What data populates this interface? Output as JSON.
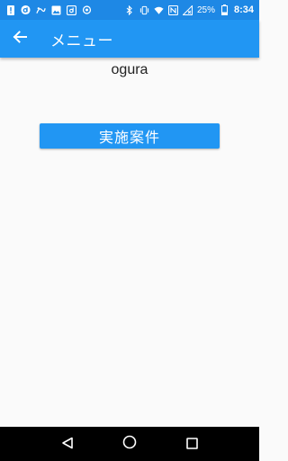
{
  "status_bar": {
    "battery": "25%",
    "time": "8:34"
  },
  "app_bar": {
    "title": "メニュー"
  },
  "main": {
    "user_name": "ogura",
    "action_button_label": "実施案件"
  },
  "colors": {
    "status_bar": "#1e88e5",
    "primary": "#2196f3",
    "background": "#fafafa",
    "nav_bar": "#000000"
  },
  "icons": {
    "status_left": [
      "alert-icon",
      "docomo-icon",
      "voice-icon",
      "image-icon",
      "docomo-app-icon",
      "sync-icon"
    ],
    "status_right": [
      "bluetooth-icon",
      "vibrate-icon",
      "wifi-icon",
      "nfc-icon",
      "no-signal-icon",
      "battery-icon"
    ],
    "app_bar": "back-arrow-icon",
    "nav_bar": [
      "back-triangle-icon",
      "home-circle-icon",
      "recents-square-icon"
    ]
  }
}
